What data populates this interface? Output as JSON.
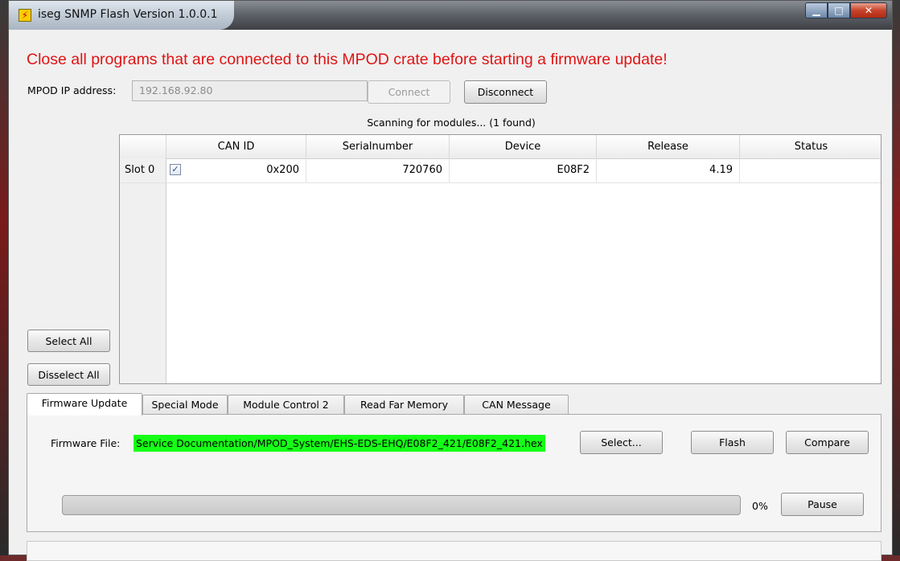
{
  "window": {
    "title": "iseg SNMP Flash Version 1.0.0.1",
    "icon": "lightning-icon",
    "controls": {
      "minimize": "minimize-icon",
      "maximize": "maximize-icon",
      "close": "close-icon"
    }
  },
  "warning": "Close all programs that are connected to this MPOD crate before starting a firmware update!",
  "connection": {
    "ip_label": "MPOD IP address:",
    "ip_value": "192.168.92.80",
    "connect_label": "Connect",
    "disconnect_label": "Disconnect",
    "status": "Scanning for modules... (1 found)"
  },
  "side_buttons": {
    "select_all": "Select All",
    "deselect_all": "Disselect All"
  },
  "table": {
    "columns": [
      "CAN ID",
      "Serialnumber",
      "Device",
      "Release",
      "Status"
    ],
    "rows": [
      {
        "slot": "Slot 0",
        "checked": true,
        "check_glyph": "✓",
        "can_id": "0x200",
        "serial": "720760",
        "device": "E08F2",
        "release": "4.19",
        "status": ""
      }
    ]
  },
  "tabs": [
    "Firmware Update",
    "Special Mode",
    "Module Control 2",
    "Read Far Memory",
    "CAN Message"
  ],
  "active_tab": "Firmware Update",
  "firmware": {
    "file_label": "Firmware File:",
    "file_path": "Service Documentation/MPOD_System/EHS-EDS-EHQ/E08F2_421/E08F2_421.hex",
    "select_label": "Select...",
    "flash_label": "Flash",
    "compare_label": "Compare",
    "progress_fraction": 0,
    "progress_text": "0%",
    "pause_label": "Pause"
  },
  "colors": {
    "warning": "#e01414",
    "file_highlight": "#16ff16"
  }
}
